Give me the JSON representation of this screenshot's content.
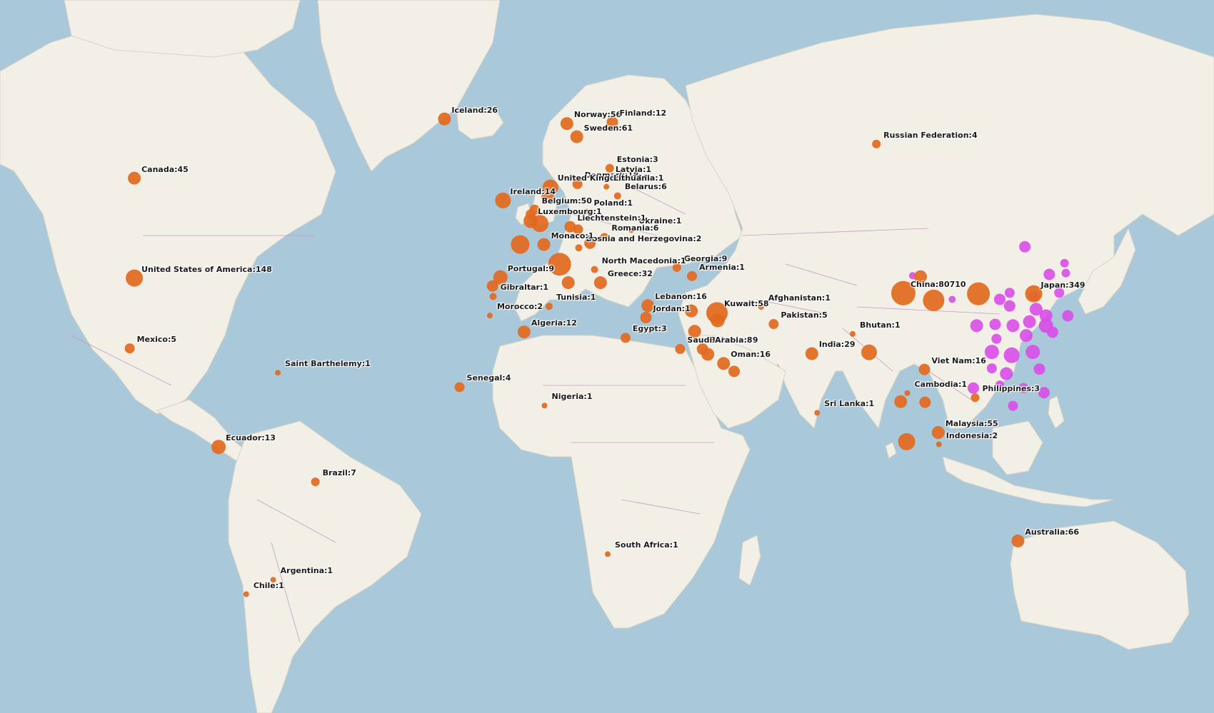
{
  "colors": {
    "ocean": "#a9c8d9",
    "ocean_deep": "#8fb6cd",
    "land": "#f2efe6",
    "border": "#c79ac8",
    "marker_other": "#e2691e",
    "marker_china": "#d94de8"
  },
  "markers": [
    {
      "country": "Iceland",
      "count": 26,
      "label": "Iceland:26"
    },
    {
      "country": "Norway",
      "count": 56,
      "label": "Norway:56"
    },
    {
      "country": "Finland",
      "count": 12,
      "label": "Finland:12"
    },
    {
      "country": "Sweden",
      "count": 61,
      "label": "Sweden:61"
    },
    {
      "country": "Russian Federation",
      "count": 4,
      "label": "Russian Federation:4"
    },
    {
      "country": "Canada",
      "count": 45,
      "label": "Canada:45"
    },
    {
      "country": "Estonia",
      "count": 3,
      "label": "Estonia:3"
    },
    {
      "country": "Denmark",
      "count": 18,
      "label": "Denmark:18"
    },
    {
      "country": "Latvia",
      "count": 1,
      "label": "Latvia:1"
    },
    {
      "country": "United Kingdom",
      "count": 118,
      "label": "United Kingdom:118"
    },
    {
      "country": "Lithuania",
      "count": 1,
      "label": "Lithuania:1"
    },
    {
      "country": "Ireland",
      "count": 14,
      "label": "Ireland:14"
    },
    {
      "country": "Belarus",
      "count": 6,
      "label": "Belarus:6"
    },
    {
      "country": "Poland",
      "count": 1,
      "label": "Poland:1"
    },
    {
      "country": "Belgium",
      "count": 50,
      "label": "Belgium:50"
    },
    {
      "country": "Luxembourg",
      "count": 1,
      "label": "Luxembourg:1"
    },
    {
      "country": "Ukraine",
      "count": 1,
      "label": "Ukraine:1"
    },
    {
      "country": "Liechtenstein",
      "count": 1,
      "label": "Liechtenstein:1"
    },
    {
      "country": "Romania",
      "count": 6,
      "label": "Romania:6"
    },
    {
      "country": "Bosnia and Herzegovina",
      "count": 2,
      "label": "Bosnia and Herzegovina:2"
    },
    {
      "country": "Monaco",
      "count": 1,
      "label": "Monaco:1"
    },
    {
      "country": "Georgia",
      "count": 9,
      "label": "Georgia:9"
    },
    {
      "country": "North Macedonia",
      "count": 1,
      "label": "North Macedonia:1"
    },
    {
      "country": "United States of America",
      "count": 148,
      "label": "United States of America:148"
    },
    {
      "country": "Armenia",
      "count": 1,
      "label": "Armenia:1"
    },
    {
      "country": "Portugal",
      "count": 9,
      "label": "Portugal:9"
    },
    {
      "country": "Greece",
      "count": 32,
      "label": "Greece:32"
    },
    {
      "country": "China",
      "count": 80710,
      "label": "China:80710"
    },
    {
      "country": "Japan",
      "count": 349,
      "label": "Japan:349"
    },
    {
      "country": "Gibraltar",
      "count": 1,
      "label": "Gibraltar:1"
    },
    {
      "country": "Lebanon",
      "count": 16,
      "label": "Lebanon:16"
    },
    {
      "country": "Tunisia",
      "count": 1,
      "label": "Tunisia:1"
    },
    {
      "country": "Afghanistan",
      "count": 1,
      "label": "Afghanistan:1"
    },
    {
      "country": "Morocco",
      "count": 2,
      "label": "Morocco:2"
    },
    {
      "country": "Jordan",
      "count": 1,
      "label": "Jordan:1"
    },
    {
      "country": "Kuwait",
      "count": 58,
      "label": "Kuwait:58"
    },
    {
      "country": "Pakistan",
      "count": 5,
      "label": "Pakistan:5"
    },
    {
      "country": "Algeria",
      "count": 12,
      "label": "Algeria:12"
    },
    {
      "country": "Egypt",
      "count": 3,
      "label": "Egypt:3"
    },
    {
      "country": "Bahrain",
      "count": 49,
      "label": "Bahrain:49"
    },
    {
      "country": "Bhutan",
      "count": 1,
      "label": "Bhutan:1"
    },
    {
      "country": "Mexico",
      "count": 5,
      "label": "Mexico:5"
    },
    {
      "country": "Saudi Arabia",
      "count": 8,
      "label": "Saudi Arabia:8"
    },
    {
      "country": "India",
      "count": 29,
      "label": "India:29"
    },
    {
      "country": "Oman",
      "count": 16,
      "label": "Oman:16"
    },
    {
      "country": "Saint Barthelemy",
      "count": 1,
      "label": "Saint Barthelemy:1"
    },
    {
      "country": "Viet Nam",
      "count": 16,
      "label": "Viet Nam:16"
    },
    {
      "country": "Senegal",
      "count": 4,
      "label": "Senegal:4"
    },
    {
      "country": "Cambodia",
      "count": 1,
      "label": "Cambodia:1"
    },
    {
      "country": "Philippines",
      "count": 3,
      "label": "Philippines:3"
    },
    {
      "country": "Nigeria",
      "count": 1,
      "label": "Nigeria:1"
    },
    {
      "country": "Sri Lanka",
      "count": 1,
      "label": "Sri Lanka:1"
    },
    {
      "country": "Malaysia",
      "count": 55,
      "label": "Malaysia:55"
    },
    {
      "country": "Ecuador",
      "count": 13,
      "label": "Ecuador:13"
    },
    {
      "country": "Indonesia",
      "count": 2,
      "label": "Indonesia:2"
    },
    {
      "country": "Brazil",
      "count": 7,
      "label": "Brazil:7"
    },
    {
      "country": "Australia",
      "count": 66,
      "label": "Australia:66"
    },
    {
      "country": "South Africa",
      "count": 1,
      "label": "South Africa:1"
    },
    {
      "country": "Argentina",
      "count": 1,
      "label": "Argentina:1"
    },
    {
      "country": "Chile",
      "count": 1,
      "label": "Chile:1"
    }
  ]
}
